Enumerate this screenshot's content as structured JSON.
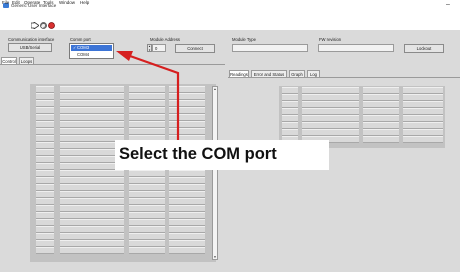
{
  "window": {
    "title": "Generic User Interface",
    "minimize_glyph": "–"
  },
  "menu": [
    "File",
    "Edit",
    "Operate",
    "Tools",
    "Window",
    "Help"
  ],
  "toolbar": {
    "icons": [
      "run-arrow-icon",
      "run-continuous-icon",
      "abort-icon"
    ]
  },
  "controls": {
    "communication_interface_label": "Communication interface",
    "communication_interface_value": "USB/Serial",
    "com_port_label": "Comm port",
    "com_port_options": [
      "COM3",
      "COM4"
    ],
    "com_port_selected": "COM3",
    "module_address_label": "Module Address",
    "module_address_value": "0",
    "connect_label": "Connect",
    "module_type_label": "Module Type",
    "module_type_value": "",
    "fw_revision_label": "FW revision",
    "fw_revision_value": "",
    "lockout_label": "Lockout"
  },
  "left_tabs": [
    "Control",
    "Loops"
  ],
  "left_tab_active": "Control",
  "right_tabs": [
    "Readings",
    "Error and Status",
    "Graph",
    "Log"
  ],
  "right_tab_active": "Readings",
  "callout": {
    "text": "Select the COM port"
  },
  "colors": {
    "panel_bg": "#dadada",
    "grid_bg": "#c2c2c2",
    "selection_blue": "#3c74d6",
    "arrow_red": "#d61f1f"
  }
}
